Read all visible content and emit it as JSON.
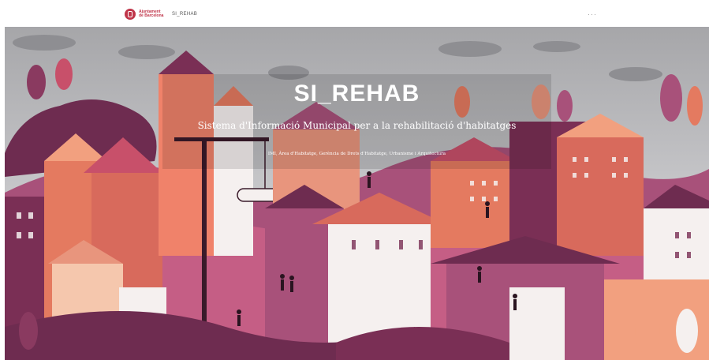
{
  "header": {
    "logo_text": "Ajuntament de Barcelona",
    "app_name": "SI_REHAB",
    "menu_icon": "more-dots-icon",
    "menu_text": "···"
  },
  "hero": {
    "title": "SI_REHAB",
    "subtitle": "Sistema d'Informació Municipal per a la rehabilitació d'habitatges",
    "credit": "IMI, Àrea d'Habitatge, Gerència de Drets d'Habitatge, Urbanisme i Arquitectura"
  },
  "colors": {
    "sky": "#b3b3b6",
    "plum": "#6e2c50",
    "mauve": "#a8517a",
    "coral": "#e47a60",
    "salmon": "#f2a07f",
    "peach": "#f5c7ad",
    "white": "#f5f0ef",
    "brand_red": "#c0364a"
  }
}
